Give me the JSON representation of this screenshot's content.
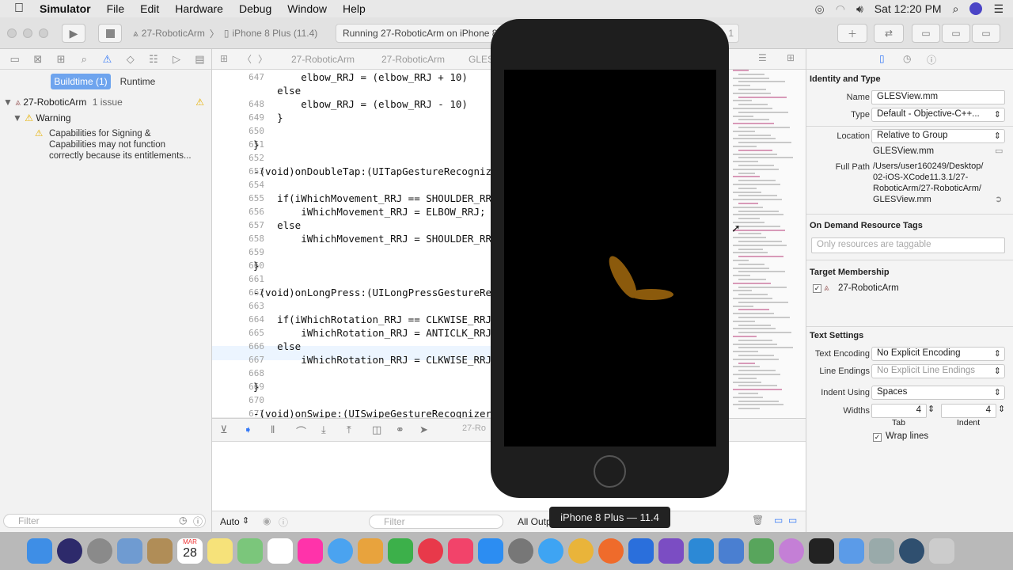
{
  "menubar": {
    "apple": "",
    "app": "Simulator",
    "items": [
      "File",
      "Edit",
      "Hardware",
      "Debug",
      "Window",
      "Help"
    ],
    "clock": "Sat 12:20 PM"
  },
  "toolbar": {
    "scheme": "27-RoboticArm",
    "device": "iPhone 8 Plus (11.4)",
    "status": "Running 27-RoboticArm on iPhone 8 Plus",
    "badge": "1"
  },
  "navigator": {
    "tab_buildtime": "Buildtime (1)",
    "tab_runtime": "Runtime",
    "project": "27-RoboticArm",
    "issues": "1 issue",
    "warning_group": "Warning",
    "warning_text": [
      "Capabilities for Signing &",
      "Capabilities may not function",
      "correctly because its entitlements..."
    ],
    "filter_placeholder": "Filter"
  },
  "jumpbar": {
    "crumbs": [
      "27-RoboticArm",
      "27-RoboticArm",
      "GLES"
    ]
  },
  "editor": {
    "lines": [
      {
        "n": "647",
        "t": "        elbow_RRJ = (elbow_RRJ + 10)"
      },
      {
        "n": "",
        "t": "    else"
      },
      {
        "n": "648",
        "t": "        elbow_RRJ = (elbow_RRJ - 10)"
      },
      {
        "n": "649",
        "t": "    }"
      },
      {
        "n": "650",
        "t": ""
      },
      {
        "n": "651",
        "t": "}"
      },
      {
        "n": "652",
        "t": ""
      },
      {
        "n": "653",
        "t": "-(void)onDoubleTap:(UITapGestureRecogniz"
      },
      {
        "n": "654",
        "t": ""
      },
      {
        "n": "655",
        "t": "    if(iWhichMovement_RRJ == SHOULDER_RRJ"
      },
      {
        "n": "656",
        "t": "        iWhichMovement_RRJ = ELBOW_RRJ;"
      },
      {
        "n": "657",
        "t": "    else"
      },
      {
        "n": "658",
        "t": "        iWhichMovement_RRJ = SHOULDER_RRJ"
      },
      {
        "n": "659",
        "t": ""
      },
      {
        "n": "660",
        "t": "}"
      },
      {
        "n": "661",
        "t": ""
      },
      {
        "n": "662",
        "t": "-(void)onLongPress:(UILongPressGestureRec"
      },
      {
        "n": "663",
        "t": ""
      },
      {
        "n": "664",
        "t": "    if(iWhichRotation_RRJ == CLKWISE_RRJ)"
      },
      {
        "n": "665",
        "t": "        iWhichRotation_RRJ = ANTICLK_RRJ;"
      },
      {
        "n": "666",
        "t": "    else"
      },
      {
        "n": "667",
        "t": "        iWhichRotation_RRJ = CLKWISE_RRJ;"
      },
      {
        "n": "668",
        "t": ""
      },
      {
        "n": "669",
        "t": "}"
      },
      {
        "n": "670",
        "t": ""
      },
      {
        "n": "671",
        "t": "-(void)onSwipe:(UISwipeGestureRecognizer*"
      }
    ]
  },
  "debug": {
    "target": "27-Ro",
    "auto": "Auto",
    "filter_placeholder": "Filter",
    "output": "All Output"
  },
  "inspector": {
    "identity_header": "Identity and Type",
    "name_label": "Name",
    "name_value": "GLESView.mm",
    "type_label": "Type",
    "type_value": "Default - Objective-C++...",
    "location_label": "Location",
    "location_value": "Relative to Group",
    "filename": "GLESView.mm",
    "fullpath_label": "Full Path",
    "fullpath": [
      "/Users/user160249/Desktop/",
      "02-iOS-XCode11.3.1/27-",
      "RoboticArm/27-RoboticArm/",
      "GLESView.mm"
    ],
    "odr_header": "On Demand Resource Tags",
    "odr_placeholder": "Only resources are taggable",
    "target_header": "Target Membership",
    "target_name": "27-RoboticArm",
    "text_header": "Text Settings",
    "encoding_label": "Text Encoding",
    "encoding_value": "No Explicit Encoding",
    "endings_label": "Line Endings",
    "endings_value": "No Explicit Line Endings",
    "indent_label": "Indent Using",
    "indent_value": "Spaces",
    "widths_label": "Widths",
    "tab_value": "4",
    "indent_width_value": "4",
    "tab_caption": "Tab",
    "indent_caption": "Indent",
    "wrap_label": "Wrap lines"
  },
  "simulator": {
    "tooltip": "iPhone 8 Plus — 11.4",
    "arm_color": "#8b5a0c"
  },
  "dock": {
    "calendar_month": "MAR",
    "calendar_day": "28"
  }
}
